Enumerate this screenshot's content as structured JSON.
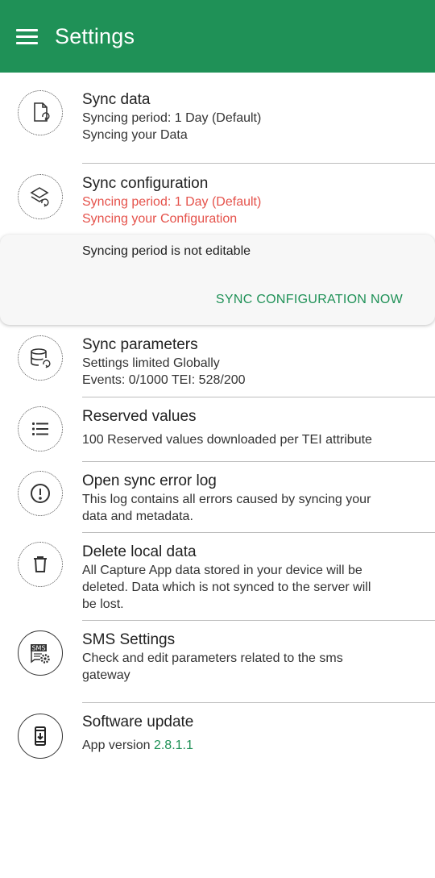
{
  "app_bar": {
    "title": "Settings",
    "menu_icon": "hamburger-menu-icon",
    "color": "#1f9157"
  },
  "items": [
    {
      "title": "Sync data",
      "lines": [
        "Syncing period: 1 Day (Default)",
        "Syncing your Data"
      ],
      "icon": "sync-data-icon"
    },
    {
      "title": "Sync configuration",
      "lines": [
        "Syncing period: 1 Day (Default)",
        "Syncing your Configuration"
      ],
      "icon": "sync-configuration-icon",
      "line_color": "#e5524b"
    },
    {
      "title": "Sync parameters",
      "lines": [
        "Settings limited Globally",
        "Events: 0/1000 TEI: 528/200"
      ],
      "icon": "sync-parameters-icon"
    },
    {
      "title": "Reserved values",
      "lines": [
        "100 Reserved values downloaded per TEI attribute"
      ],
      "icon": "list-icon"
    },
    {
      "title": "Open sync error log",
      "lines": [
        "This log contains all errors caused by syncing your",
        "data and metadata."
      ],
      "icon": "error-icon"
    },
    {
      "title": "Delete local data",
      "lines": [
        "All Capture App data stored in your device will be",
        "deleted. Data which is not synced to the server will",
        "be lost."
      ],
      "icon": "trash-icon"
    },
    {
      "title": "SMS Settings",
      "lines": [
        "Check and edit parameters related to the sms",
        "gateway"
      ],
      "icon": "sms-settings-icon"
    },
    {
      "title": "Software update",
      "version_label": "App version",
      "version_value": "2.8.1.1",
      "icon": "download-phone-icon"
    }
  ],
  "sync_config_panel": {
    "note": "Syncing period is not editable",
    "action": "SYNC CONFIGURATION NOW"
  }
}
